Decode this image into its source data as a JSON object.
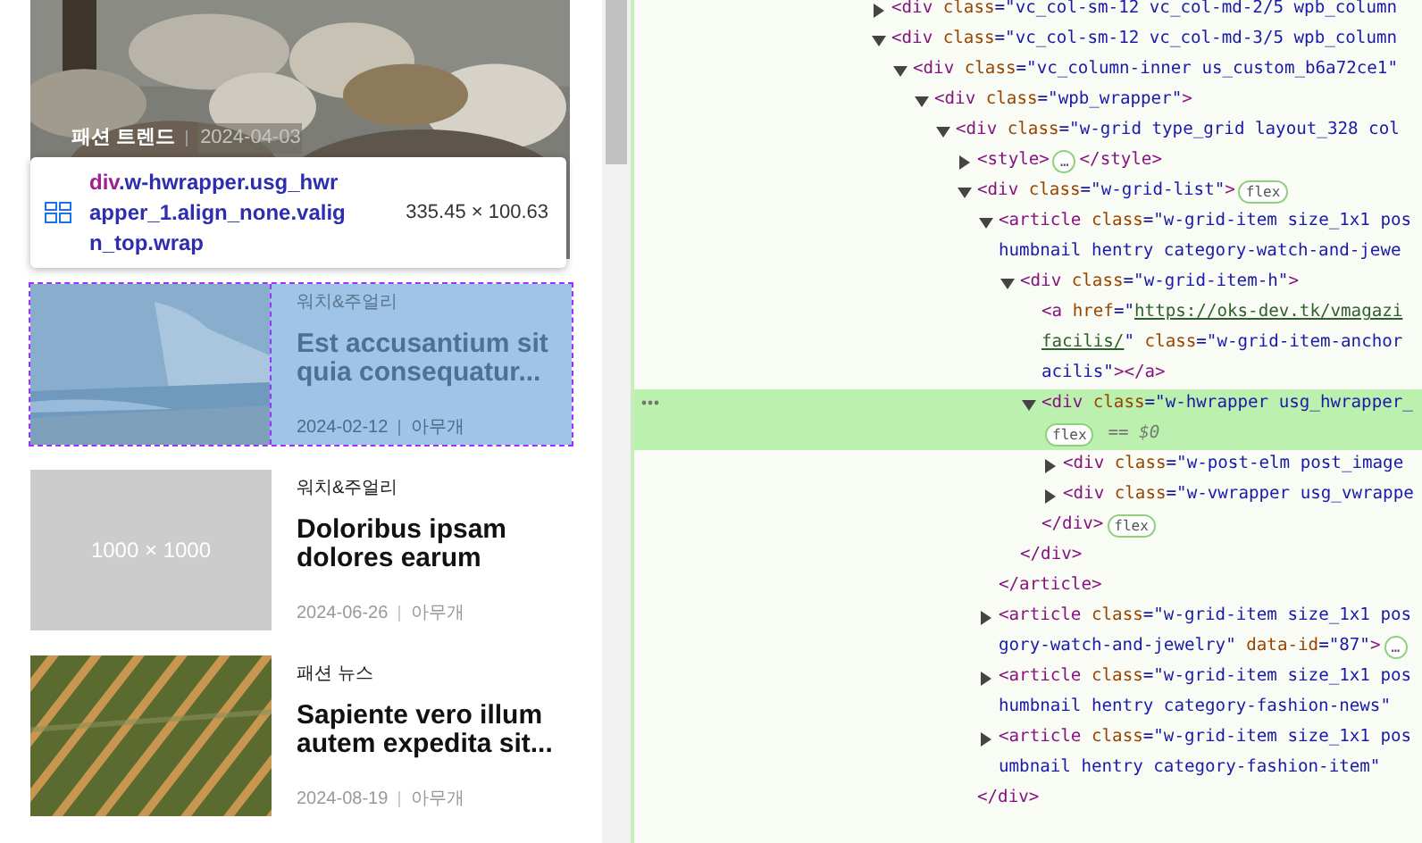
{
  "page": {
    "featured": {
      "category": "패션 트렌드",
      "date": "2024-04-03"
    },
    "tooltip": {
      "tag": "div",
      "selector_lines": [
        ".w-hwrapper.usg_hwr",
        "apper_1.align_none.valig",
        "n_top.wrap"
      ],
      "size": "335.45 × 100.63"
    },
    "cards": [
      {
        "category": "워치&주얼리",
        "title": "Est accusantium sit quia consequatur...",
        "date": "2024-02-12",
        "author": "아무개",
        "highlighted": true
      },
      {
        "category": "워치&주얼리",
        "title": "Doloribus ipsam dolores earum",
        "date": "2024-06-26",
        "author": "아무개",
        "highlighted": false,
        "image": {
          "kind": "placeholder",
          "text": "1000 × 1000"
        }
      },
      {
        "category": "패션 뉴스",
        "title": "Sapiente vero illum autem expedita sit...",
        "date": "2024-08-19",
        "author": "아무개",
        "highlighted": false
      }
    ]
  },
  "elements_tree": [
    {
      "expandable": true,
      "expanded": false,
      "selected": false,
      "lines": [
        [
          {
            "kind": "tag",
            "text": "<div"
          },
          {
            "kind": "attr",
            "text": " class"
          },
          {
            "kind": "value",
            "text": "=\"vc_col-sm-12 vc_col-md-2/5 wpb_column"
          }
        ]
      ]
    },
    {
      "expandable": true,
      "expanded": true,
      "selected": false,
      "lines": [
        [
          {
            "kind": "tag",
            "text": "<div"
          },
          {
            "kind": "attr",
            "text": " class"
          },
          {
            "kind": "value",
            "text": "=\"vc_col-sm-12 vc_col-md-3/5 wpb_column"
          }
        ]
      ],
      "children": [
        {
          "expandable": true,
          "expanded": true,
          "selected": false,
          "lines": [
            [
              {
                "kind": "tag",
                "text": "<div"
              },
              {
                "kind": "attr",
                "text": " class"
              },
              {
                "kind": "value",
                "text": "=\"vc_column-inner us_custom_b6a72ce1\""
              }
            ]
          ],
          "children": [
            {
              "expandable": true,
              "expanded": true,
              "selected": false,
              "lines": [
                [
                  {
                    "kind": "tag",
                    "text": "<div"
                  },
                  {
                    "kind": "attr",
                    "text": " class"
                  },
                  {
                    "kind": "value",
                    "text": "=\"wpb_wrapper\""
                  },
                  {
                    "kind": "tag",
                    "text": ">"
                  }
                ]
              ],
              "children": [
                {
                  "expandable": true,
                  "expanded": true,
                  "selected": false,
                  "lines": [
                    [
                      {
                        "kind": "tag",
                        "text": "<div"
                      },
                      {
                        "kind": "attr",
                        "text": " class"
                      },
                      {
                        "kind": "value",
                        "text": "=\"w-grid type_grid layout_328 col"
                      }
                    ]
                  ],
                  "children": [
                    {
                      "expandable": true,
                      "expanded": false,
                      "selected": false,
                      "lines": [
                        [
                          {
                            "kind": "tag",
                            "text": "<style>"
                          },
                          {
                            "kind": "badge",
                            "text": "…"
                          },
                          {
                            "kind": "tag",
                            "text": "</style>"
                          }
                        ]
                      ]
                    },
                    {
                      "expandable": true,
                      "expanded": true,
                      "selected": false,
                      "lines": [
                        [
                          {
                            "kind": "tag",
                            "text": "<div"
                          },
                          {
                            "kind": "attr",
                            "text": " class"
                          },
                          {
                            "kind": "value",
                            "text": "=\"w-grid-list\""
                          },
                          {
                            "kind": "tag",
                            "text": ">"
                          },
                          {
                            "kind": "badge",
                            "text": "flex"
                          }
                        ]
                      ],
                      "closing": [
                        {
                          "kind": "tag",
                          "text": "</div>"
                        }
                      ],
                      "children": [
                        {
                          "expandable": true,
                          "expanded": true,
                          "selected": false,
                          "lines": [
                            [
                              {
                                "kind": "tag",
                                "text": "<article"
                              },
                              {
                                "kind": "attr",
                                "text": " class"
                              },
                              {
                                "kind": "value",
                                "text": "=\"w-grid-item size_1x1 pos"
                              }
                            ],
                            [
                              {
                                "kind": "value",
                                "text": "humbnail hentry category-watch-and-jewe"
                              }
                            ]
                          ],
                          "closing": [
                            {
                              "kind": "tag",
                              "text": "</article>"
                            }
                          ],
                          "children": [
                            {
                              "expandable": true,
                              "expanded": true,
                              "selected": false,
                              "lines": [
                                [
                                  {
                                    "kind": "tag",
                                    "text": "<div"
                                  },
                                  {
                                    "kind": "attr",
                                    "text": " class"
                                  },
                                  {
                                    "kind": "value",
                                    "text": "=\"w-grid-item-h\""
                                  },
                                  {
                                    "kind": "tag",
                                    "text": ">"
                                  }
                                ]
                              ],
                              "closing": [
                                {
                                  "kind": "tag",
                                  "text": "</div>"
                                }
                              ],
                              "children": [
                                {
                                  "expandable": false,
                                  "expanded": false,
                                  "selected": false,
                                  "lines": [
                                    [
                                      {
                                        "kind": "tag",
                                        "text": "<a"
                                      },
                                      {
                                        "kind": "attr",
                                        "text": " href"
                                      },
                                      {
                                        "kind": "value",
                                        "text": "=\""
                                      },
                                      {
                                        "kind": "link",
                                        "text": "https://oks-dev.tk/vmagazi"
                                      }
                                    ],
                                    [
                                      {
                                        "kind": "link",
                                        "text": "facilis/"
                                      },
                                      {
                                        "kind": "value",
                                        "text": "\""
                                      },
                                      {
                                        "kind": "attr",
                                        "text": " class"
                                      },
                                      {
                                        "kind": "value",
                                        "text": "=\"w-grid-item-anchor"
                                      }
                                    ],
                                    [
                                      {
                                        "kind": "value",
                                        "text": "acilis\""
                                      },
                                      {
                                        "kind": "tag",
                                        "text": "></a>"
                                      }
                                    ]
                                  ]
                                },
                                {
                                  "expandable": true,
                                  "expanded": true,
                                  "selected": true,
                                  "lines": [
                                    [
                                      {
                                        "kind": "tag",
                                        "text": "<div"
                                      },
                                      {
                                        "kind": "attr",
                                        "text": " class"
                                      },
                                      {
                                        "kind": "value",
                                        "text": "=\"w-hwrapper usg_hwrapper_"
                                      }
                                    ],
                                    [
                                      {
                                        "kind": "badge",
                                        "text": "flex"
                                      },
                                      {
                                        "kind": "note",
                                        "text": "== $0"
                                      }
                                    ]
                                  ],
                                  "closing": [
                                    {
                                      "kind": "tag",
                                      "text": "</div>"
                                    },
                                    {
                                      "kind": "badge",
                                      "text": "flex"
                                    }
                                  ],
                                  "children": [
                                    {
                                      "expandable": true,
                                      "expanded": false,
                                      "selected": false,
                                      "lines": [
                                        [
                                          {
                                            "kind": "tag",
                                            "text": "<div"
                                          },
                                          {
                                            "kind": "attr",
                                            "text": " class"
                                          },
                                          {
                                            "kind": "value",
                                            "text": "=\"w-post-elm post_image"
                                          }
                                        ]
                                      ]
                                    },
                                    {
                                      "expandable": true,
                                      "expanded": false,
                                      "selected": false,
                                      "lines": [
                                        [
                                          {
                                            "kind": "tag",
                                            "text": "<div"
                                          },
                                          {
                                            "kind": "attr",
                                            "text": " class"
                                          },
                                          {
                                            "kind": "value",
                                            "text": "=\"w-vwrapper usg_vwrappe"
                                          }
                                        ]
                                      ]
                                    }
                                  ]
                                }
                              ]
                            }
                          ]
                        },
                        {
                          "expandable": true,
                          "expanded": false,
                          "selected": false,
                          "lines": [
                            [
                              {
                                "kind": "tag",
                                "text": "<article"
                              },
                              {
                                "kind": "attr",
                                "text": " class"
                              },
                              {
                                "kind": "value",
                                "text": "=\"w-grid-item size_1x1 pos"
                              }
                            ],
                            [
                              {
                                "kind": "value",
                                "text": "gory-watch-and-jewelry\""
                              },
                              {
                                "kind": "attr",
                                "text": " data-id"
                              },
                              {
                                "kind": "value",
                                "text": "=\"87\""
                              },
                              {
                                "kind": "tag",
                                "text": ">"
                              },
                              {
                                "kind": "badge",
                                "text": "…"
                              }
                            ]
                          ]
                        },
                        {
                          "expandable": true,
                          "expanded": false,
                          "selected": false,
                          "lines": [
                            [
                              {
                                "kind": "tag",
                                "text": "<article"
                              },
                              {
                                "kind": "attr",
                                "text": " class"
                              },
                              {
                                "kind": "value",
                                "text": "=\"w-grid-item size_1x1 pos"
                              }
                            ],
                            [
                              {
                                "kind": "value",
                                "text": "humbnail hentry category-fashion-news\""
                              }
                            ]
                          ]
                        },
                        {
                          "expandable": true,
                          "expanded": false,
                          "selected": false,
                          "lines": [
                            [
                              {
                                "kind": "tag",
                                "text": "<article"
                              },
                              {
                                "kind": "attr",
                                "text": " class"
                              },
                              {
                                "kind": "value",
                                "text": "=\"w-grid-item size_1x1 pos"
                              }
                            ],
                            [
                              {
                                "kind": "value",
                                "text": "umbnail hentry category-fashion-item\""
                              }
                            ]
                          ]
                        }
                      ]
                    }
                  ]
                }
              ]
            }
          ]
        }
      ]
    }
  ]
}
